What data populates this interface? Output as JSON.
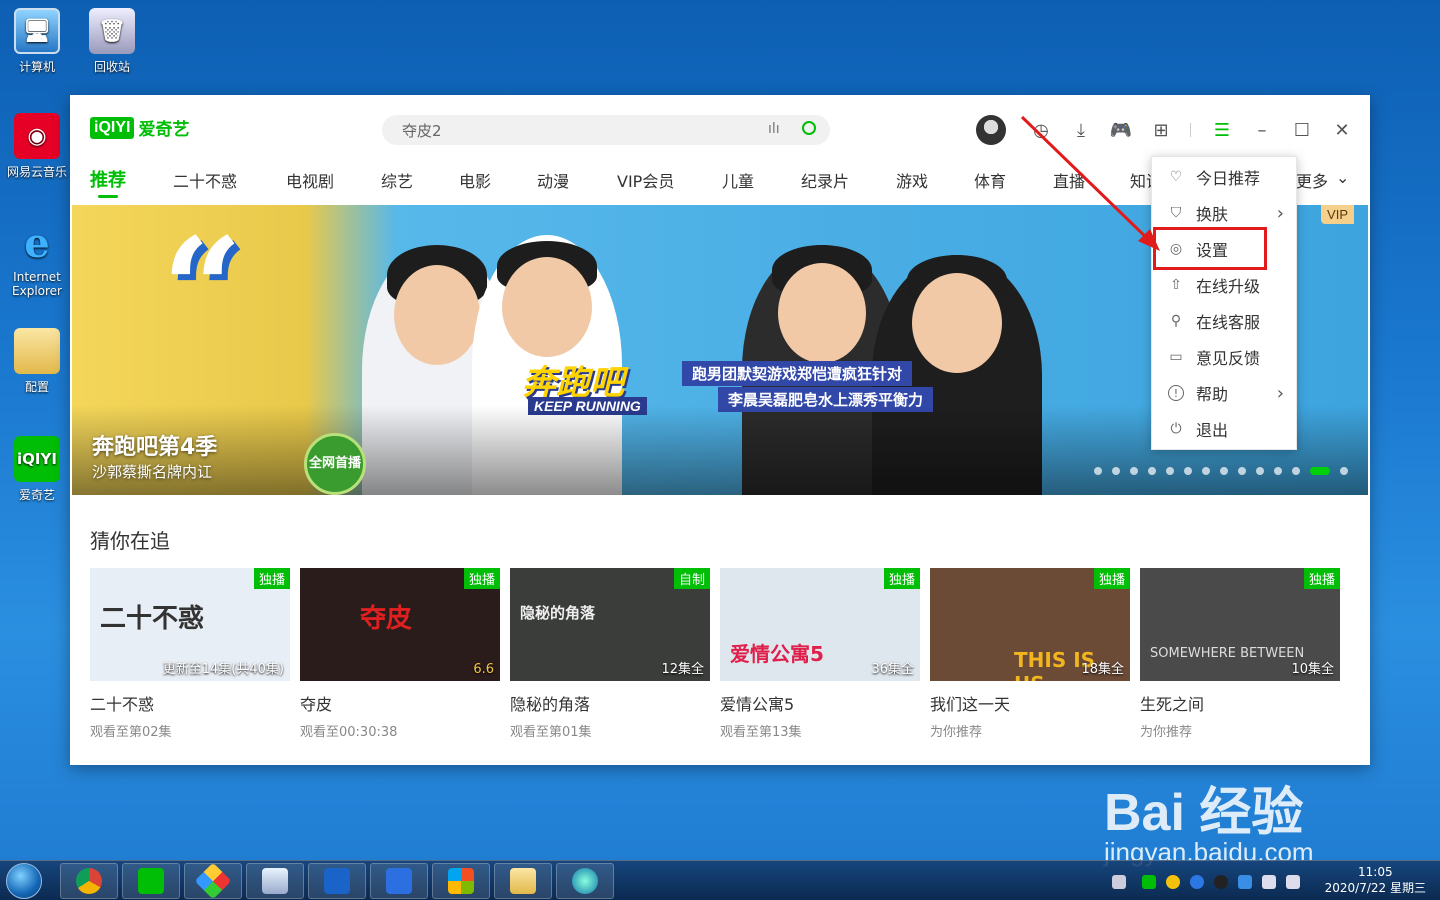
{
  "desktop": {
    "icons": [
      {
        "label": "计算机"
      },
      {
        "label": "回收站"
      },
      {
        "label": "网易云音乐"
      },
      {
        "label": "Internet Explorer"
      },
      {
        "label": "配置"
      },
      {
        "label": "爱奇艺"
      }
    ]
  },
  "app": {
    "logo_mark": "iQIYI",
    "logo_text": "爱奇艺",
    "search": {
      "value": "夺皮2"
    },
    "nav": [
      "推荐",
      "二十不惑",
      "电视剧",
      "综艺",
      "电影",
      "动漫",
      "VIP会员",
      "儿童",
      "纪录片",
      "游戏",
      "体育",
      "直播",
      "知识",
      "更多"
    ],
    "nav_active": "推荐",
    "banner": {
      "title": "奔跑吧第4季",
      "subtitle": "沙郭蔡撕名牌内讧",
      "vip": "VIP",
      "show_title": "奔跑吧",
      "show_en": "KEEP RUNNING",
      "line1": "跑男团默契游戏郑恺遭疯狂针对",
      "line2": "李晨吴磊肥皂水上漂秀平衡力",
      "badge": "全网首播",
      "slide_count": 14,
      "active_slide": 12
    },
    "section_title": "猜你在追",
    "cards": [
      {
        "name": "二十不惑",
        "progress": "观看至第02集",
        "tag": "独播",
        "episodes": "更新至14集(共40集)",
        "art": "二十不惑",
        "bg": "#e8eef5",
        "color": "#333"
      },
      {
        "name": "夺皮",
        "progress": "观看至00:30:38",
        "tag": "独播",
        "episodes": "6.6",
        "art": "夺皮",
        "bg": "#2a1c1a",
        "color": "#e02020"
      },
      {
        "name": "隐秘的角落",
        "progress": "观看至第01集",
        "tag": "自制",
        "episodes": "12集全",
        "art": "隐秘的角落",
        "bg": "#3b3d3a",
        "color": "#eee"
      },
      {
        "name": "爱情公寓5",
        "progress": "观看至第13集",
        "tag": "独播",
        "episodes": "36集全",
        "art": "爱情公寓5",
        "bg": "#dfe7ee",
        "color": "#e0204a"
      },
      {
        "name": "我们这一天",
        "progress": "为你推荐",
        "tag": "独播",
        "episodes": "18集全",
        "art": "THIS IS US",
        "bg": "#6b4a36",
        "color": "#f2b51e"
      },
      {
        "name": "生死之间",
        "progress": "为你推荐",
        "tag": "独播",
        "episodes": "10集全",
        "art": "SOMEWHERE BETWEEN",
        "bg": "#4a4a4a",
        "color": "#ddd"
      }
    ],
    "menu": [
      {
        "label": "今日推荐",
        "icon": "heart-icon",
        "glyph": "♡",
        "arrow": false
      },
      {
        "label": "换肤",
        "icon": "shirt-icon",
        "glyph": "👕",
        "arrow": true
      },
      {
        "label": "设置",
        "icon": "gear-icon",
        "glyph": "◎",
        "arrow": false
      },
      {
        "label": "在线升级",
        "icon": "upgrade-icon",
        "glyph": "⇧",
        "arrow": false
      },
      {
        "label": "在线客服",
        "icon": "service-icon",
        "glyph": "⚲",
        "arrow": false
      },
      {
        "label": "意见反馈",
        "icon": "feedback-icon",
        "glyph": "▭",
        "arrow": false
      },
      {
        "label": "帮助",
        "icon": "help-icon",
        "glyph": "!",
        "arrow": true
      },
      {
        "label": "退出",
        "icon": "power-icon",
        "glyph": "⏻",
        "arrow": false
      }
    ],
    "highlighted_menu_item": "设置"
  },
  "taskbar": {
    "time": "11:05",
    "date": "2020/7/22 星期三"
  },
  "watermark": {
    "line1": "Bai 经验",
    "line2": "jingyan.baidu.com"
  },
  "colors": {
    "accent": "#00be06",
    "highlight_box": "#e11b1b"
  }
}
